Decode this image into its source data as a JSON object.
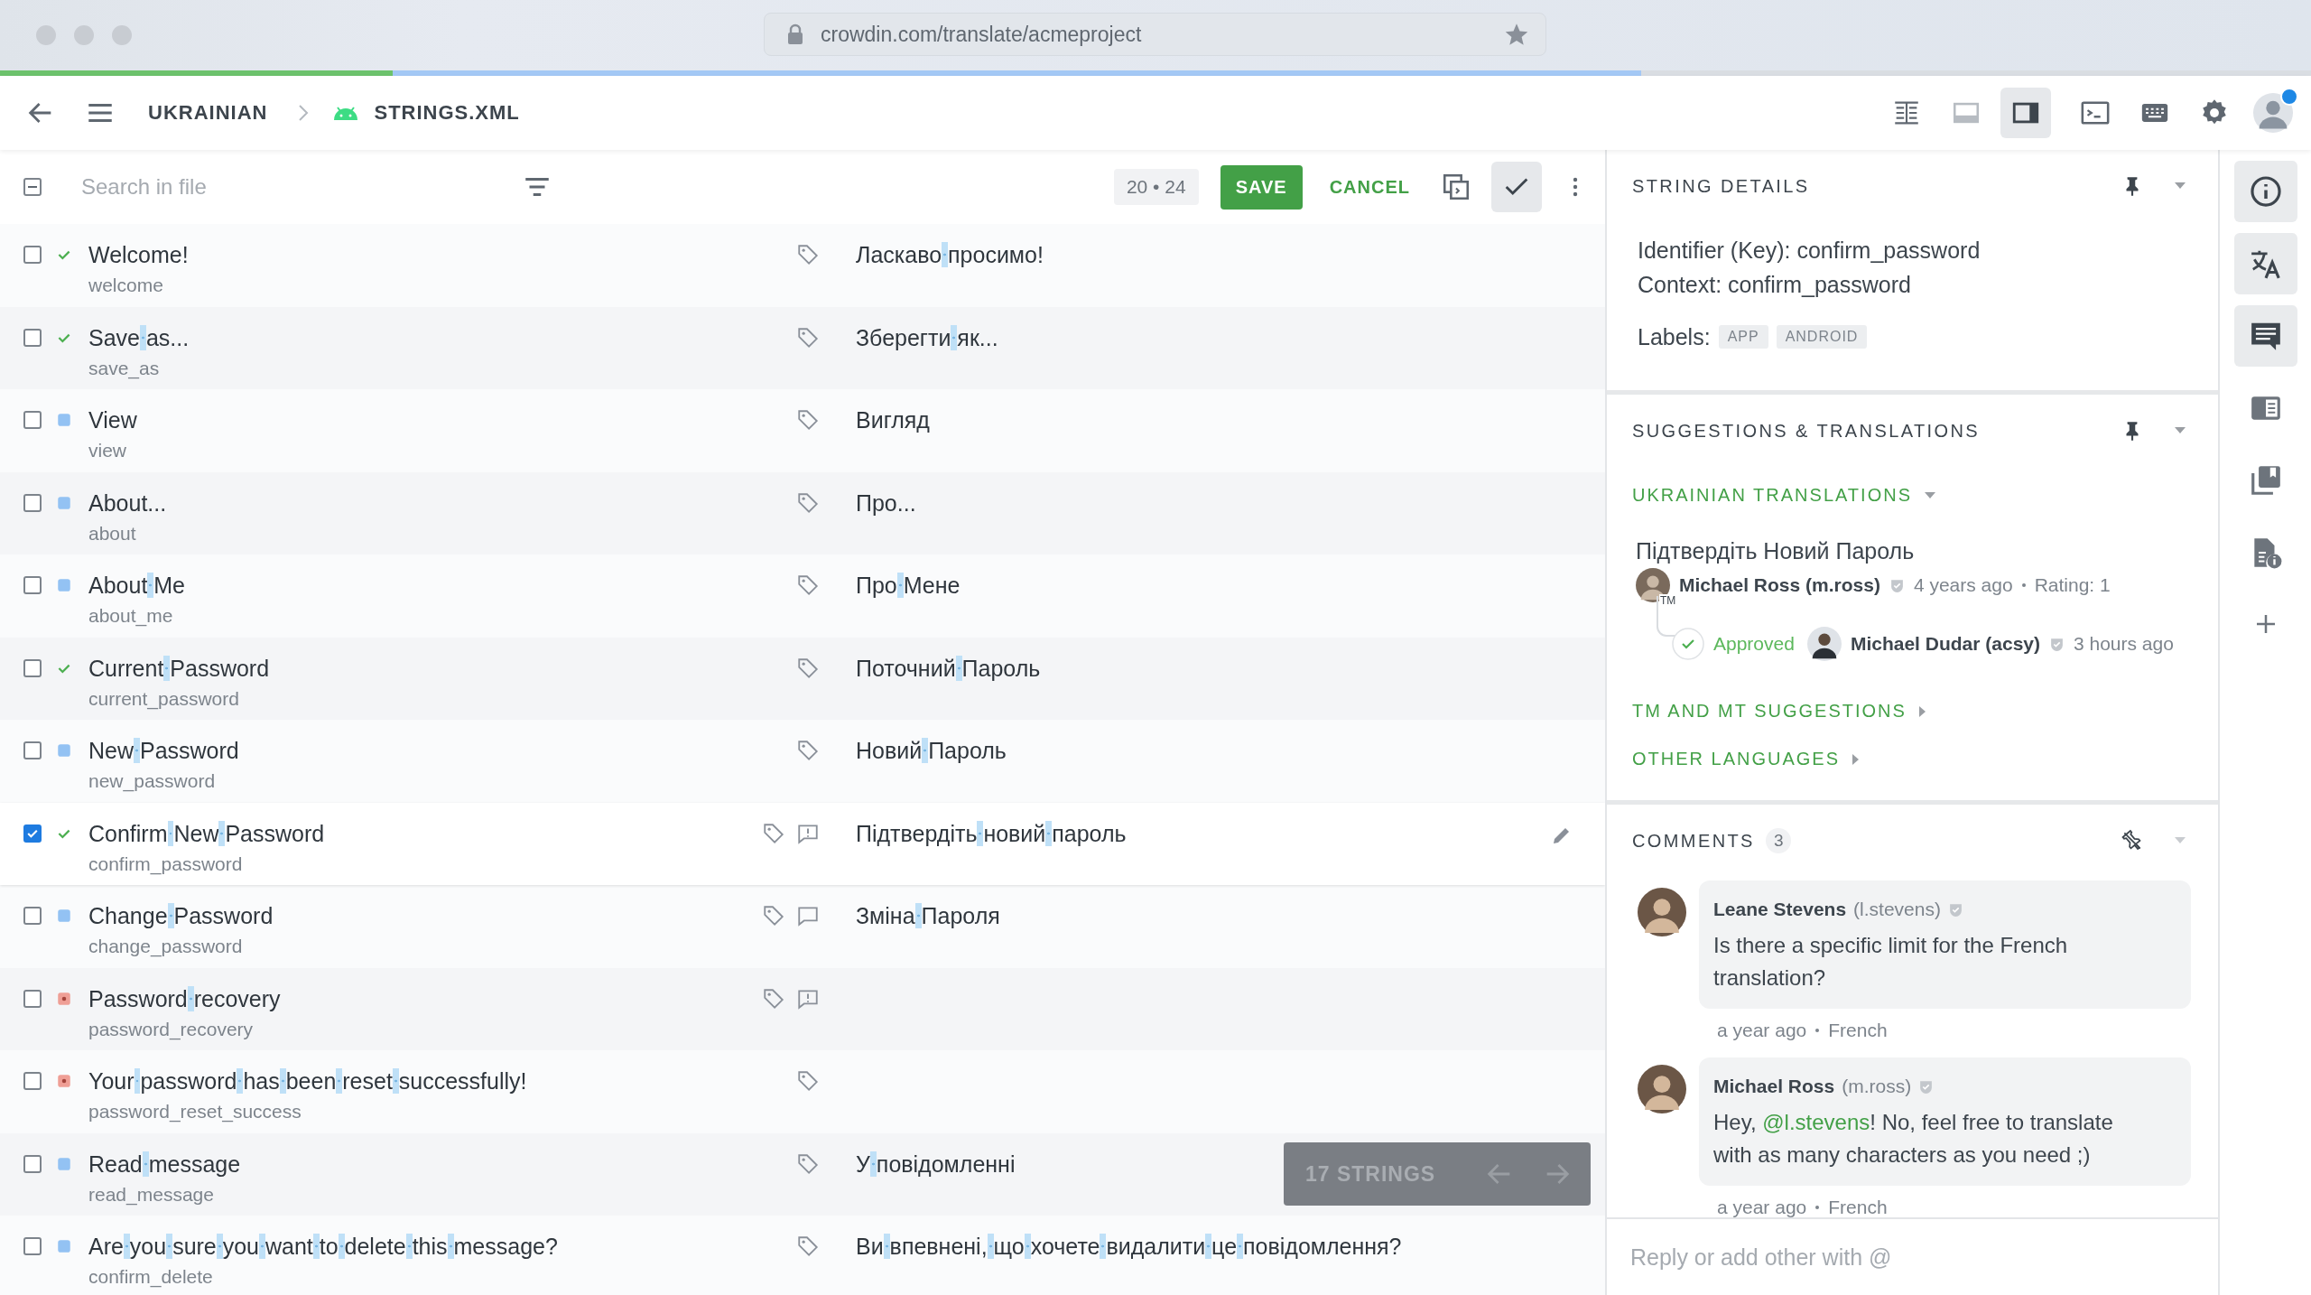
{
  "browser": {
    "url": "crowdin.com/translate/acmeproject"
  },
  "progress_bar": {
    "fills": [
      {
        "kind": "translated",
        "level": 0.71
      },
      {
        "kind": "approved",
        "level": 0.17
      }
    ]
  },
  "toolbar": {
    "breadcrumb": [
      "UKRAINIAN",
      "STRINGS.XML"
    ],
    "layout_modes": [
      {
        "kind": "columns",
        "selected": false
      },
      {
        "kind": "horizontal",
        "selected": false
      },
      {
        "kind": "sidebar",
        "selected": true
      }
    ],
    "account": {
      "notification": true
    }
  },
  "editor": {
    "select_all": {
      "indeterminate": true
    },
    "search": {
      "placeholder": "Search in file"
    },
    "counter": "20 • 24",
    "save": "SAVE",
    "cancel": "CANCEL",
    "approve_toggle": {
      "selected": true
    },
    "rows": [
      {
        "kind": "approved",
        "source": "Welcome!",
        "key": "welcome",
        "translation": "Ласкаво просимо!",
        "selected": false
      },
      {
        "kind": "approved",
        "source": "Save as...",
        "key": "save_as",
        "translation": "Зберегти як...",
        "selected": false
      },
      {
        "kind": "translated",
        "source": "View",
        "key": "view",
        "translation": "Вигляд",
        "selected": false
      },
      {
        "kind": "translated",
        "source": "About...",
        "key": "about",
        "translation": "Про...",
        "selected": false
      },
      {
        "kind": "translated",
        "source": "About Me",
        "key": "about_me",
        "translation": "Про Мене",
        "selected": false
      },
      {
        "kind": "approved",
        "source": "Current Password",
        "key": "current_password",
        "translation": "Поточний Пароль",
        "selected": false
      },
      {
        "kind": "translated",
        "source": "New Password",
        "key": "new_password",
        "translation": "Новий Пароль",
        "selected": false
      },
      {
        "kind": "approved",
        "source": "Confirm New Password",
        "key": "confirm_password",
        "translation": "Підтвердіть новий пароль",
        "selected": true,
        "comment": {
          "kind": "issue"
        }
      },
      {
        "kind": "translated",
        "source": "Change Password",
        "key": "change_password",
        "translation": "Зміна Пароля",
        "selected": false,
        "comment": {
          "kind": "note"
        }
      },
      {
        "kind": "untranslated",
        "source": "Password recovery",
        "key": "password_recovery",
        "selected": false,
        "comment": {
          "kind": "issue"
        }
      },
      {
        "kind": "untranslated",
        "source": "Your password has been reset successfully!",
        "key": "password_reset_success",
        "selected": false
      },
      {
        "kind": "translated",
        "source": "Read message",
        "key": "read_message",
        "translation": "У повідомленні",
        "selected": false
      },
      {
        "kind": "translated",
        "source": "Are you sure you want to delete this message?",
        "key": "confirm_delete",
        "translation": "Ви впевнені, що хочете видалити це повідомлення?",
        "selected": false
      }
    ],
    "pager": {
      "label": "17 STRINGS"
    }
  },
  "string_details": {
    "title": "STRING DETAILS",
    "identifier": "Identifier (Key): confirm_password",
    "context": "Context: confirm_password",
    "labels_caption": "Labels:",
    "labels": [
      "APP",
      "ANDROID"
    ]
  },
  "suggestions": {
    "title": "SUGGESTIONS & TRANSLATIONS",
    "groups": [
      {
        "title": "UKRAINIAN TRANSLATIONS",
        "expanded": true
      },
      {
        "title": "TM AND MT SUGGESTIONS",
        "expanded": false
      },
      {
        "title": "OTHER LANGUAGES",
        "expanded": false
      }
    ],
    "translation": {
      "text": "Підтвердіть Новий Пароль",
      "author": "Michael Ross (m.ross)",
      "badge": "TM",
      "time": "4 years ago",
      "rating": "Rating: 1",
      "approval": {
        "label": "Approved",
        "by": "Michael Dudar (acsy)",
        "time": "3 hours ago"
      }
    }
  },
  "comments": {
    "title": "COMMENTS",
    "count": "3",
    "items": [
      {
        "author": "Leane Stevens",
        "handle": "(l.stevens)",
        "before": "Is there a specific limit for the French translation?",
        "time": "a year ago",
        "language": "French"
      },
      {
        "author": "Michael Ross",
        "handle": "(m.ross)",
        "before": "Hey, ",
        "mention": "@l.stevens",
        "after": "! No, feel free to translate with as many characters as you need ;)",
        "time": "a year ago",
        "language": "French"
      }
    ],
    "reply": {
      "placeholder": "Reply or add other with @"
    }
  },
  "rail": [
    {
      "kind": "info",
      "selected": true
    },
    {
      "kind": "translate",
      "selected": true
    },
    {
      "kind": "comments",
      "selected": true
    },
    {
      "kind": "glossary",
      "selected": false
    },
    {
      "kind": "bookmarks",
      "selected": false
    },
    {
      "kind": "file-info",
      "selected": false
    }
  ]
}
